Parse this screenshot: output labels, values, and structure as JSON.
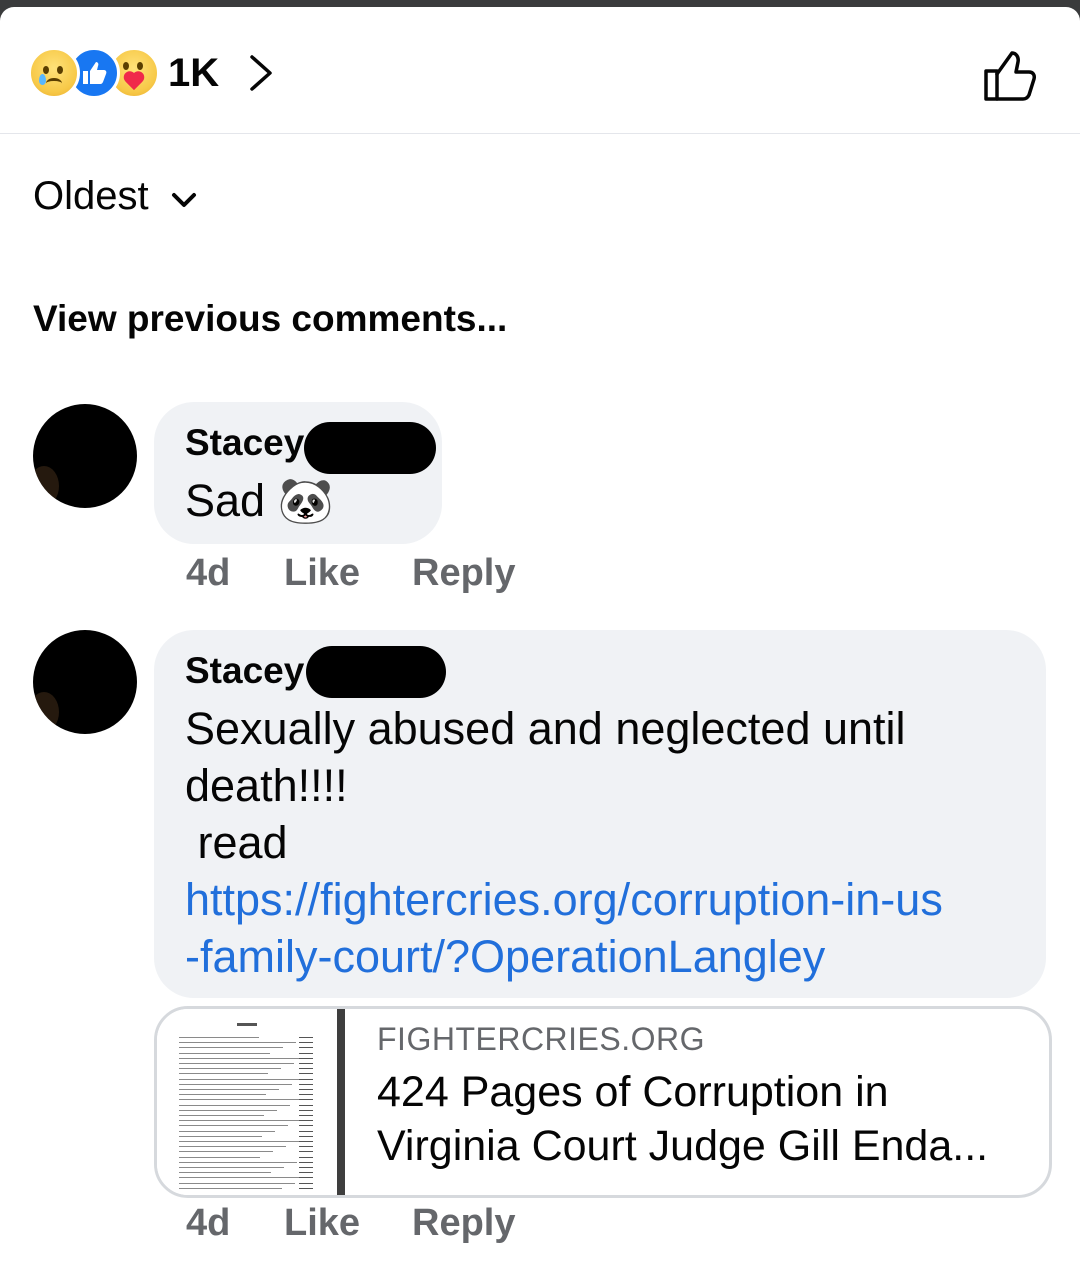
{
  "reactions": {
    "icons": [
      "sad-reaction-icon",
      "like-reaction-icon",
      "care-reaction-icon"
    ],
    "count": "1K"
  },
  "sort": {
    "label": "Oldest"
  },
  "view_previous": "View previous comments...",
  "comments": [
    {
      "author": "Stacey",
      "text": "Sad 🐼",
      "time": "4d",
      "like_label": "Like",
      "reply_label": "Reply"
    },
    {
      "author": "Stacey",
      "text_lines": [
        "Sexually abused and neglected until",
        "death!!!!",
        " read"
      ],
      "link_lines": [
        "https://fightercries.org/corruption-in-us",
        "-family-court/?OperationLangley"
      ],
      "preview": {
        "domain": "FIGHTERCRIES.ORG",
        "title": "424 Pages of Corruption in\nVirginia Court Judge Gill Enda..."
      },
      "time": "4d",
      "like_label": "Like",
      "reply_label": "Reply"
    }
  ],
  "colors": {
    "link": "#216fdb",
    "bubble": "#f0f2f5",
    "meta": "#65676b",
    "like_blue": "#1877f2"
  }
}
